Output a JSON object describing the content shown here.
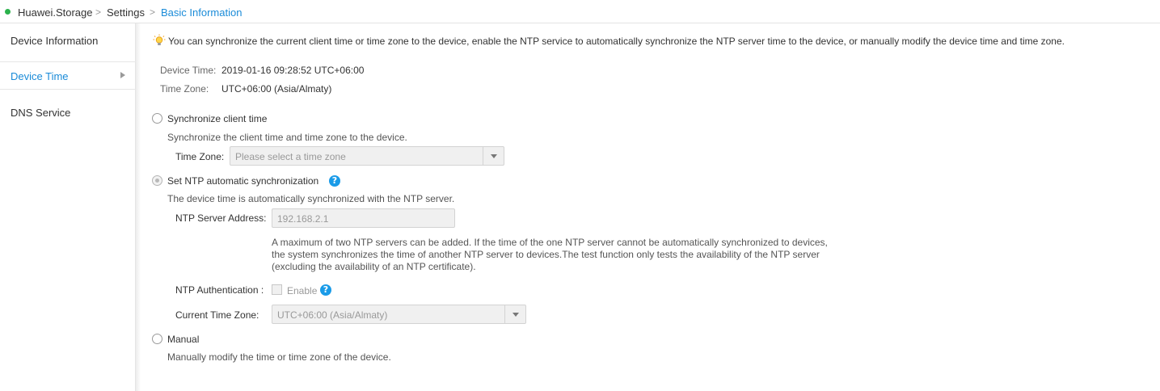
{
  "breadcrumb": {
    "root": "Huawei.Storage",
    "settings": "Settings",
    "current": "Basic Information"
  },
  "sidebar": {
    "items": [
      {
        "label": "Device Information"
      },
      {
        "label": "Device Time"
      },
      {
        "label": "DNS Service"
      }
    ]
  },
  "main": {
    "tip": "You can synchronize the current client time or time zone to the device, enable the NTP service to automatically synchronize the NTP server time to the device, or manually modify the device time and time zone.",
    "device_time_label": "Device Time:",
    "device_time_value": "2019-01-16 09:28:52 UTC+06:00",
    "time_zone_label": "Time Zone:",
    "time_zone_value": "UTC+06:00 (Asia/Almaty)",
    "sync_client": {
      "title": "Synchronize client time",
      "desc": "Synchronize the client time and time zone to the device.",
      "tz_label": "Time Zone:",
      "tz_placeholder": "Please select a time zone"
    },
    "ntp": {
      "title": "Set NTP automatic synchronization",
      "desc": "The device time is automatically synchronized with the NTP server.",
      "server_label": "NTP Server Address:",
      "server_value": "192.168.2.1",
      "note_1": "A maximum of two NTP servers can be added. If the time of the one NTP server cannot be automatically synchronized to devices,",
      "note_2": "the system synchronizes the time of another NTP server to devices.The test function only tests the availability of the NTP server",
      "note_3": "(excluding the availability of an NTP certificate).",
      "auth_label": "NTP Authentication :",
      "enable_label": "Enable",
      "ctz_label": "Current Time Zone:",
      "ctz_value": "UTC+06:00 (Asia/Almaty)"
    },
    "manual": {
      "title": "Manual",
      "desc": "Manually modify the time or time zone of the device."
    },
    "help_glyph": "?"
  },
  "colors": {
    "accent": "#1a8bd8",
    "status_ok": "#2bb24c",
    "help": "#1a9be8"
  },
  "selected_option": "Set NTP automatic synchronization"
}
